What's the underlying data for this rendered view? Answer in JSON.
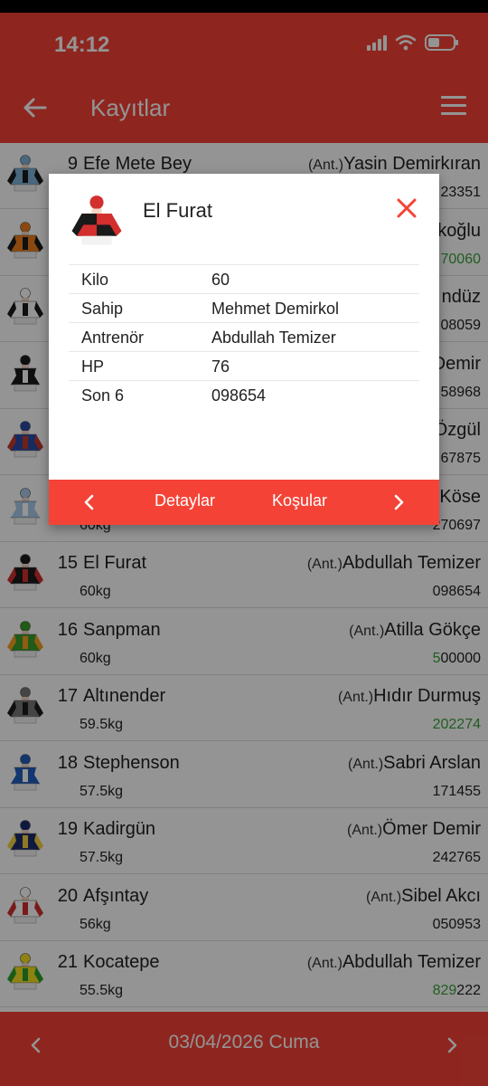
{
  "status_bar": {
    "time": "14:12"
  },
  "app_bar": {
    "title": "Kayıtlar"
  },
  "rows": [
    {
      "num": "9",
      "name": "Efe Mete Bey",
      "kg": "",
      "ant": "(Ant.)",
      "jockey": "Yasin Demirkıran",
      "code_green": "",
      "code_rest": "23351",
      "silk": [
        "#7fb3d8",
        "#1a1a1a"
      ]
    },
    {
      "num": "",
      "name": "",
      "kg": "",
      "ant": "",
      "jockey": "koğlu",
      "code_green": "70060",
      "code_rest": "",
      "silk": [
        "#f07f1a",
        "#1a1a1a"
      ]
    },
    {
      "num": "",
      "name": "",
      "kg": "",
      "ant": "",
      "jockey": "ndüz",
      "code_green": "",
      "code_rest": "08059",
      "silk": [
        "#ffffff",
        "#1a1a1a"
      ]
    },
    {
      "num": "",
      "name": "",
      "kg": "",
      "ant": "",
      "jockey": "Demir",
      "code_green": "",
      "code_rest": "58968",
      "silk": [
        "#1a1a1a",
        "#ffffff"
      ]
    },
    {
      "num": "",
      "name": "",
      "kg": "",
      "ant": "",
      "jockey": "Özgül",
      "code_green": "",
      "code_rest": "67875",
      "silk": [
        "#2a4aa8",
        "#c0392b"
      ]
    },
    {
      "num": "",
      "name": "",
      "kg": "60kg",
      "ant": "",
      "jockey": "Köse",
      "code_green": "",
      "code_rest": "270697",
      "silk": [
        "#a9cbe8",
        "#ffffff"
      ]
    },
    {
      "num": "15",
      "name": "El Furat",
      "kg": "60kg",
      "ant": "(Ant.)",
      "jockey": "Abdullah Temizer",
      "code_green": "",
      "code_rest": "098654",
      "silk": [
        "#1a1a1a",
        "#d32f2f"
      ]
    },
    {
      "num": "16",
      "name": "Sanpman",
      "kg": "60kg",
      "ant": "(Ant.)",
      "jockey": "Atilla Gökçe",
      "code_green": "5",
      "code_rest": "00000",
      "silk": [
        "#3a9d2a",
        "#f4a020"
      ]
    },
    {
      "num": "17",
      "name": "Altınender",
      "kg": "59.5kg",
      "ant": "(Ant.)",
      "jockey": "Hıdır Durmuş",
      "code_green": "202274",
      "code_rest": "",
      "silk": [
        "#777777",
        "#1a1a1a"
      ]
    },
    {
      "num": "18",
      "name": "Stephenson",
      "kg": "57.5kg",
      "ant": "(Ant.)",
      "jockey": "Sabri Arslan",
      "code_green": "",
      "code_rest": "171455",
      "silk": [
        "#1f5fbf",
        "#ffffff"
      ]
    },
    {
      "num": "19",
      "name": "Kadirgün",
      "kg": "57.5kg",
      "ant": "(Ant.)",
      "jockey": "Ömer Demir",
      "code_green": "",
      "code_rest": "242765",
      "silk": [
        "#1a2a6c",
        "#f4d03f"
      ]
    },
    {
      "num": "20",
      "name": "Afşıntay",
      "kg": "56kg",
      "ant": "(Ant.)",
      "jockey": "Sibel Akcı",
      "code_green": "",
      "code_rest": "050953",
      "silk": [
        "#ffffff",
        "#d32f2f"
      ]
    },
    {
      "num": "21",
      "name": "Kocatepe",
      "kg": "55.5kg",
      "ant": "(Ant.)",
      "jockey": "Abdullah Temizer",
      "code_green": "829",
      "code_rest": "222",
      "silk": [
        "#f4e020",
        "#2a9d2a"
      ]
    }
  ],
  "dialog": {
    "title": "El Furat",
    "fields": [
      {
        "label": "Kilo",
        "value": "60"
      },
      {
        "label": "Sahip",
        "value": "Mehmet Demirkol"
      },
      {
        "label": "Antrenör",
        "value": "Abdullah Temizer"
      },
      {
        "label": "HP",
        "value": "76"
      },
      {
        "label": "Son 6",
        "value": "098654"
      }
    ],
    "details_label": "Detaylar",
    "runs_label": "Koşular"
  },
  "bottom_bar": {
    "date": "03/04/2026 Cuma"
  },
  "colors": {
    "accent": "#f44336",
    "green": "#3aa03a"
  }
}
